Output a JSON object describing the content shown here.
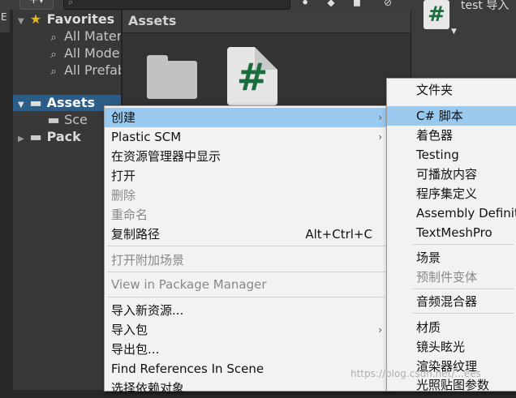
{
  "toolbar": {
    "left_glyph": "E",
    "plus_label": "+▾",
    "search_placeholder": "",
    "icons": [
      "filter-icon",
      "favorite-icon",
      "label-icon",
      "visibility-icon"
    ]
  },
  "tree": {
    "favorites_label": "Favorites",
    "favorite_items": [
      "All Mater",
      "All Mode",
      "All Prefab"
    ],
    "assets_label": "Assets",
    "assets_child": "Sce",
    "packages_label": "Pack"
  },
  "assets_panel": {
    "title": "Assets",
    "script_icon_glyph": "#"
  },
  "inspector": {
    "title": "test 导入",
    "icon_glyph": "#"
  },
  "context_menu": {
    "items": [
      {
        "label": "创建",
        "shortcut": "",
        "submenu": true,
        "disabled": false,
        "highlighted": true
      },
      {
        "label": "Plastic SCM",
        "shortcut": "",
        "submenu": true,
        "disabled": false
      },
      {
        "label": "在资源管理器中显示",
        "shortcut": "",
        "submenu": false,
        "disabled": false
      },
      {
        "label": "打开",
        "shortcut": "",
        "submenu": false,
        "disabled": false
      },
      {
        "label": "删除",
        "shortcut": "",
        "submenu": false,
        "disabled": true
      },
      {
        "label": "重命名",
        "shortcut": "",
        "submenu": false,
        "disabled": true
      },
      {
        "label": "复制路径",
        "shortcut": "Alt+Ctrl+C",
        "submenu": false,
        "disabled": false
      },
      {
        "label": "打开附加场景",
        "shortcut": "",
        "submenu": false,
        "disabled": true
      },
      {
        "label": "View in Package Manager",
        "shortcut": "",
        "submenu": false,
        "disabled": true
      },
      {
        "label": "导入新资源...",
        "shortcut": "",
        "submenu": false,
        "disabled": false
      },
      {
        "label": "导入包",
        "shortcut": "",
        "submenu": true,
        "disabled": false
      },
      {
        "label": "导出包...",
        "shortcut": "",
        "submenu": false,
        "disabled": false
      },
      {
        "label": "Find References In Scene",
        "shortcut": "",
        "submenu": false,
        "disabled": false
      },
      {
        "label": "选择依赖对象",
        "shortcut": "",
        "submenu": false,
        "disabled": false
      }
    ],
    "submenu_arrow": "›"
  },
  "create_submenu": {
    "items": [
      {
        "label": "文件夹",
        "disabled": false
      },
      {
        "label": "C# 脚本",
        "disabled": false,
        "highlighted": true
      },
      {
        "label": "着色器",
        "disabled": false
      },
      {
        "label": "Testing",
        "disabled": false
      },
      {
        "label": "可播放内容",
        "disabled": false
      },
      {
        "label": "程序集定义",
        "disabled": false
      },
      {
        "label": "Assembly Definition",
        "disabled": false
      },
      {
        "label": "TextMeshPro",
        "disabled": false
      },
      {
        "label": "场景",
        "disabled": false
      },
      {
        "label": "预制件变体",
        "disabled": true
      },
      {
        "label": "音频混合器",
        "disabled": false
      },
      {
        "label": "材质",
        "disabled": false
      },
      {
        "label": "镜头眩光",
        "disabled": false
      },
      {
        "label": "渲染器纹理",
        "disabled": false
      },
      {
        "label": "光照贴图参数",
        "disabled": false
      }
    ]
  },
  "watermark": "https://blog.csdn.net/...ees",
  "colors": {
    "editor_bg": "#282828",
    "panel_bg": "#383838",
    "selection": "#2c5d87",
    "menu_bg": "#f2f2f2",
    "menu_highlight": "#99c9ef",
    "script_green": "#1b6d3d",
    "favorite_star": "#e8b829"
  }
}
